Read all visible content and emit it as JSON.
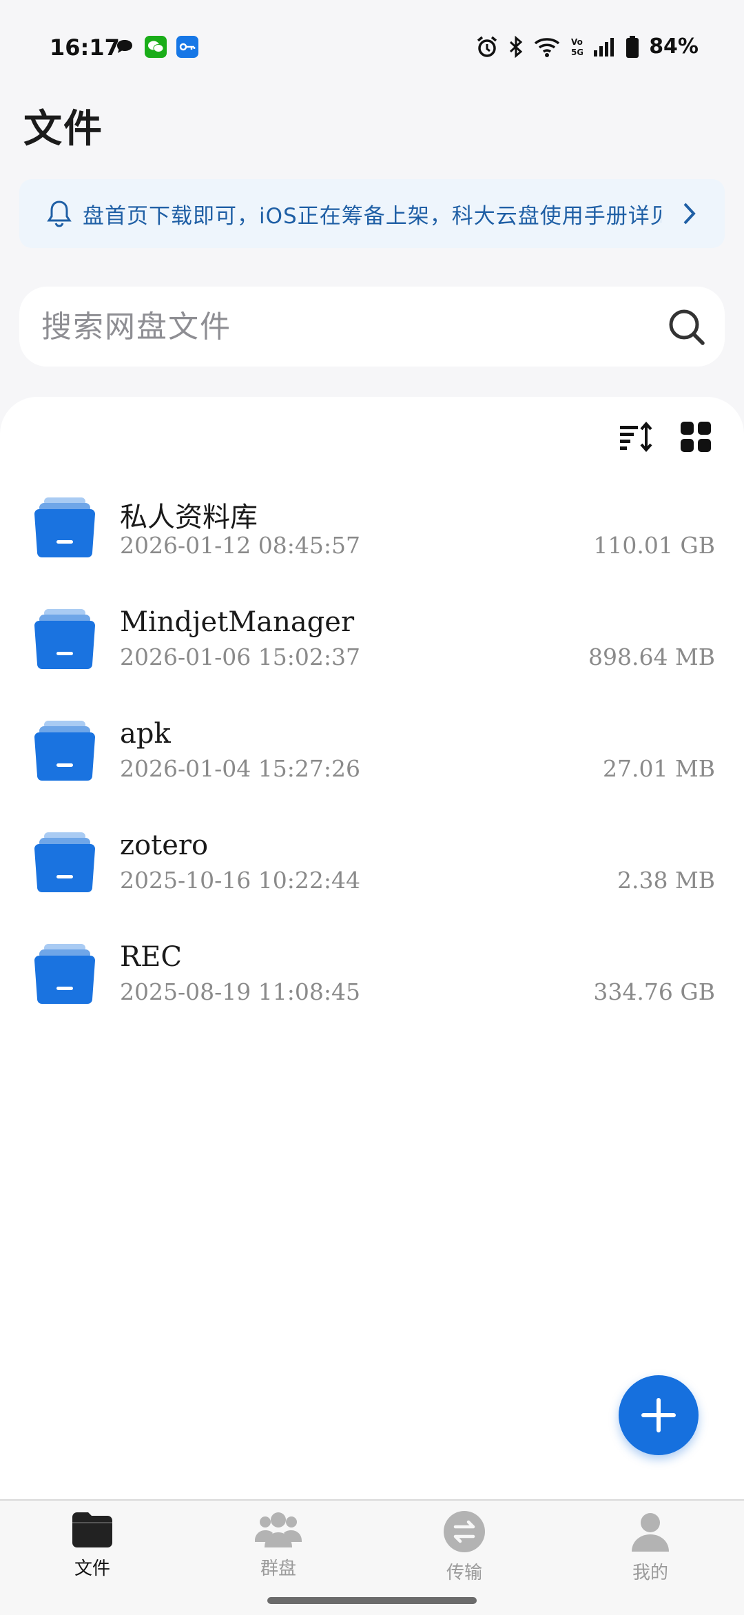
{
  "status_bar": {
    "time": "16:17",
    "battery": "84%",
    "left_icons": [
      "chat-bubble-icon",
      "wechat-icon",
      "vpn-key-icon"
    ],
    "right_icons": [
      "alarm-icon",
      "bluetooth-icon",
      "wifi-icon",
      "volte-icon",
      "signal-icon",
      "battery-icon"
    ]
  },
  "header": {
    "title": "文件"
  },
  "notice": {
    "text": "盘首页下载即可，iOS正在筹备上架，科大云盘使用手册详见"
  },
  "search": {
    "placeholder": "搜索网盘文件"
  },
  "toolbar": {
    "sort_icon": "sort-icon",
    "grid_icon": "grid-view-icon"
  },
  "files": [
    {
      "name": "私人资料库",
      "date": "2026-01-12 08:45:57",
      "size": "110.01 GB"
    },
    {
      "name": "MindjetManager",
      "date": "2026-01-06 15:02:37",
      "size": "898.64 MB"
    },
    {
      "name": "apk",
      "date": "2026-01-04 15:27:26",
      "size": "27.01 MB"
    },
    {
      "name": "zotero",
      "date": "2025-10-16 10:22:44",
      "size": "2.38 MB"
    },
    {
      "name": "REC",
      "date": "2025-08-19 11:08:45",
      "size": "334.76 GB"
    }
  ],
  "nav": {
    "items": [
      {
        "label": "文件",
        "active": true
      },
      {
        "label": "群盘",
        "active": false
      },
      {
        "label": "传输",
        "active": false
      },
      {
        "label": "我的",
        "active": false
      }
    ]
  },
  "colors": {
    "accent": "#1670de",
    "folder_front": "#1a73e0",
    "folder_back": "#8dbbef",
    "notice_text": "#1f5fa5"
  }
}
